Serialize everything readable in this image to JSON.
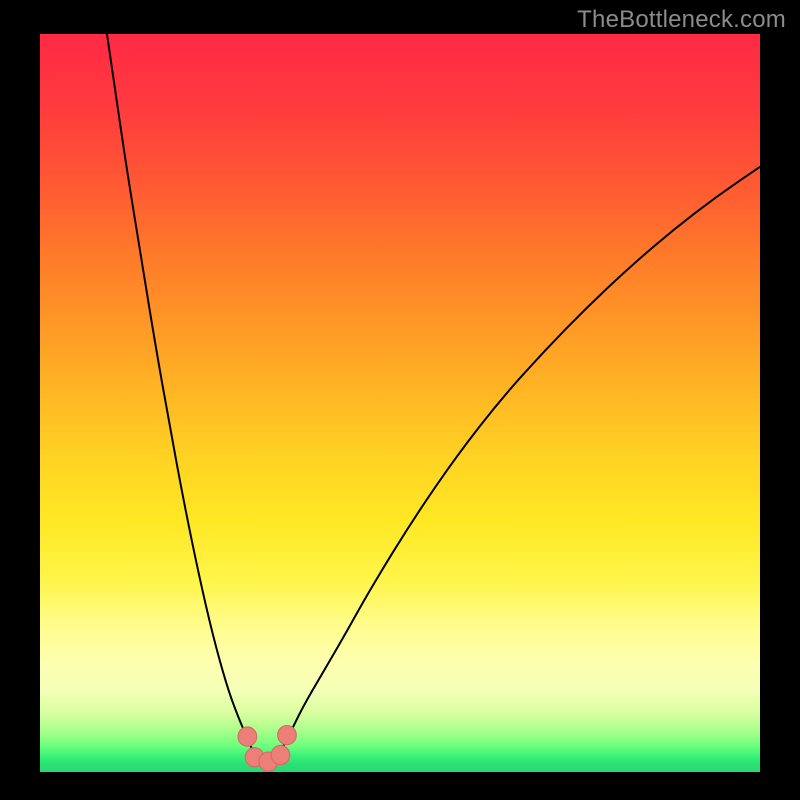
{
  "watermark": "TheBottleneck.com",
  "colors": {
    "black": "#000000",
    "curve": "#000000",
    "marker_fill": "#ec7f78",
    "marker_stroke": "#d46a63",
    "gradient_stops": [
      {
        "offset": 0.0,
        "color": "#ff2a45"
      },
      {
        "offset": 0.1,
        "color": "#ff3b3e"
      },
      {
        "offset": 0.2,
        "color": "#ff5833"
      },
      {
        "offset": 0.3,
        "color": "#ff7a2a"
      },
      {
        "offset": 0.4,
        "color": "#ff9a26"
      },
      {
        "offset": 0.5,
        "color": "#ffbb24"
      },
      {
        "offset": 0.58,
        "color": "#ffd423"
      },
      {
        "offset": 0.66,
        "color": "#ffe824"
      },
      {
        "offset": 0.74,
        "color": "#fff54a"
      },
      {
        "offset": 0.8,
        "color": "#fffc8b"
      },
      {
        "offset": 0.85,
        "color": "#feffaf"
      },
      {
        "offset": 0.89,
        "color": "#f4ffb6"
      },
      {
        "offset": 0.92,
        "color": "#d9ffa0"
      },
      {
        "offset": 0.945,
        "color": "#a6ff8a"
      },
      {
        "offset": 0.965,
        "color": "#6bff7d"
      },
      {
        "offset": 0.978,
        "color": "#3cf276"
      },
      {
        "offset": 0.99,
        "color": "#2ae073"
      },
      {
        "offset": 1.0,
        "color": "#29d873"
      }
    ]
  },
  "chart_data": {
    "type": "line",
    "title": "",
    "xlabel": "",
    "ylabel": "",
    "xlim": [
      0,
      100
    ],
    "ylim": [
      0,
      100
    ],
    "grid": false,
    "curves": [
      {
        "name": "left-curve",
        "points": [
          {
            "x": 9.0,
            "y": 102.0
          },
          {
            "x": 10.5,
            "y": 92.0
          },
          {
            "x": 12.0,
            "y": 82.0
          },
          {
            "x": 14.0,
            "y": 70.0
          },
          {
            "x": 16.0,
            "y": 58.0
          },
          {
            "x": 18.0,
            "y": 47.0
          },
          {
            "x": 20.0,
            "y": 36.5
          },
          {
            "x": 22.0,
            "y": 27.0
          },
          {
            "x": 24.0,
            "y": 18.5
          },
          {
            "x": 26.0,
            "y": 11.5
          },
          {
            "x": 27.5,
            "y": 7.5
          },
          {
            "x": 28.7,
            "y": 4.8
          },
          {
            "x": 29.5,
            "y": 3.0
          }
        ]
      },
      {
        "name": "right-curve",
        "points": [
          {
            "x": 33.5,
            "y": 3.0
          },
          {
            "x": 34.5,
            "y": 4.8
          },
          {
            "x": 36.5,
            "y": 8.8
          },
          {
            "x": 39.0,
            "y": 13.0
          },
          {
            "x": 42.0,
            "y": 18.0
          },
          {
            "x": 46.0,
            "y": 25.0
          },
          {
            "x": 52.0,
            "y": 34.5
          },
          {
            "x": 58.0,
            "y": 43.0
          },
          {
            "x": 64.0,
            "y": 50.5
          },
          {
            "x": 70.0,
            "y": 57.0
          },
          {
            "x": 76.0,
            "y": 63.0
          },
          {
            "x": 82.0,
            "y": 68.5
          },
          {
            "x": 88.0,
            "y": 73.5
          },
          {
            "x": 94.0,
            "y": 78.0
          },
          {
            "x": 100.0,
            "y": 82.0
          }
        ]
      },
      {
        "name": "bottom-arc",
        "points": [
          {
            "x": 29.5,
            "y": 3.0
          },
          {
            "x": 30.3,
            "y": 1.7
          },
          {
            "x": 31.2,
            "y": 1.3
          },
          {
            "x": 32.0,
            "y": 1.3
          },
          {
            "x": 32.8,
            "y": 1.7
          },
          {
            "x": 33.5,
            "y": 3.0
          }
        ]
      }
    ],
    "markers": [
      {
        "x": 28.8,
        "y": 4.8,
        "r": 1.3
      },
      {
        "x": 29.8,
        "y": 2.0,
        "r": 1.3
      },
      {
        "x": 31.7,
        "y": 1.4,
        "r": 1.3
      },
      {
        "x": 33.4,
        "y": 2.3,
        "r": 1.3
      },
      {
        "x": 34.3,
        "y": 5.0,
        "r": 1.3
      }
    ]
  }
}
